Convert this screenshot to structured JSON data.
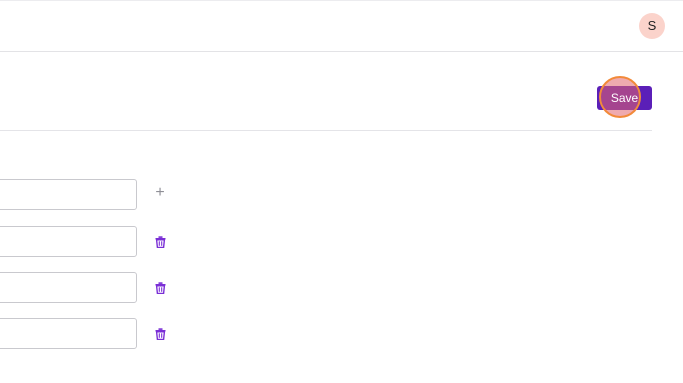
{
  "header": {
    "avatar_initial": "S"
  },
  "toolbar": {
    "save_label": "Save"
  },
  "form": {
    "rows": [
      {
        "value": "",
        "action_icon": "plus-icon"
      },
      {
        "value": "",
        "action_icon": "trash-icon"
      },
      {
        "value": "",
        "action_icon": "trash-icon"
      },
      {
        "value": "",
        "action_icon": "trash-icon"
      }
    ]
  },
  "colors": {
    "primary": "#5b1fb8",
    "delete_icon": "#7a2fd6",
    "avatar_bg": "#fbd3cb",
    "focus_ring": "#f28a3a"
  }
}
